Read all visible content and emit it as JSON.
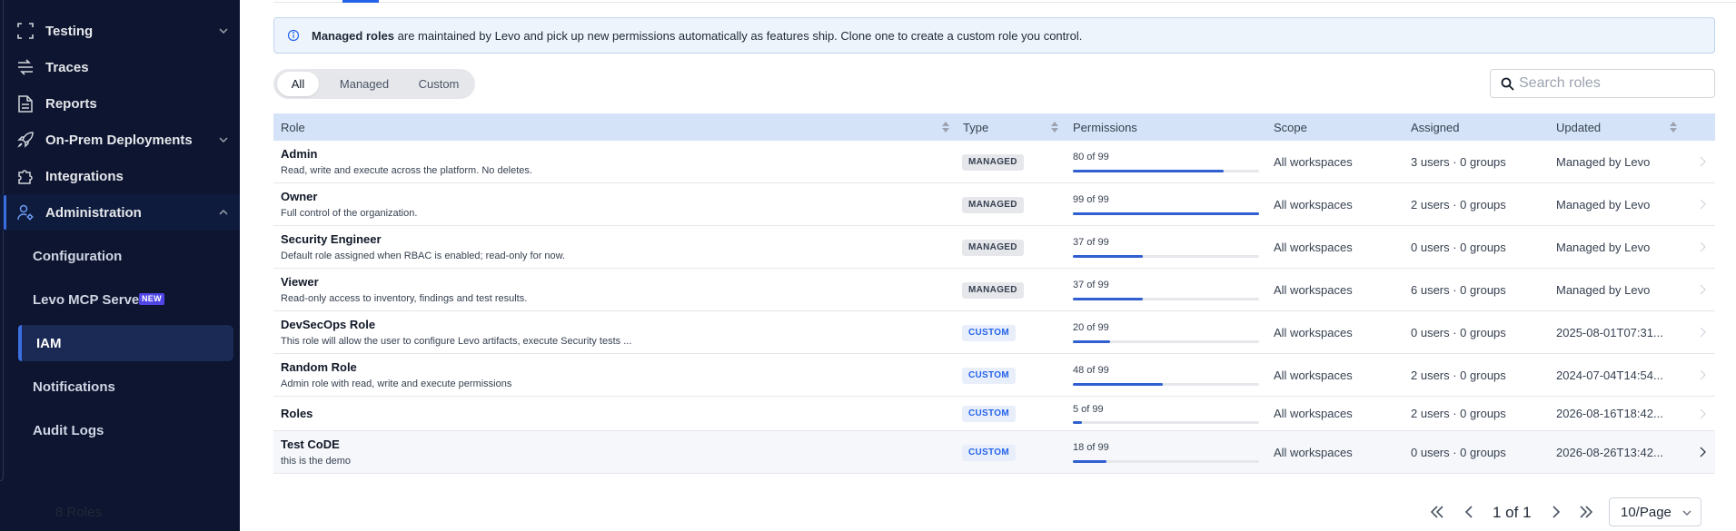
{
  "sidebar": {
    "items": [
      {
        "label": "Testing",
        "icon": "scan-icon",
        "has_chevron": true
      },
      {
        "label": "Traces",
        "icon": "traces-icon",
        "has_chevron": false
      },
      {
        "label": "Reports",
        "icon": "document-icon",
        "has_chevron": false
      },
      {
        "label": "On-Prem Deployments",
        "icon": "rocket-icon",
        "has_chevron": true
      },
      {
        "label": "Integrations",
        "icon": "puzzle-icon",
        "has_chevron": false
      },
      {
        "label": "Administration",
        "icon": "user-gear-icon",
        "has_chevron": true,
        "expanded": true
      }
    ],
    "sub_items": [
      {
        "label": "Configuration"
      },
      {
        "label": "Levo MCP Server",
        "badge": "NEW"
      },
      {
        "label": "IAM",
        "selected": true
      },
      {
        "label": "Notifications"
      },
      {
        "label": "Audit Logs"
      }
    ]
  },
  "banner": {
    "bold": "Managed roles",
    "text": " are maintained by Levo and pick up new permissions automatically as features ship. Clone one to create a custom role you control."
  },
  "filters": {
    "all": "All",
    "managed": "Managed",
    "custom": "Custom",
    "active": "All"
  },
  "search": {
    "placeholder": "Search roles",
    "value": ""
  },
  "table": {
    "headers": {
      "role": "Role",
      "type": "Type",
      "permissions": "Permissions",
      "scope": "Scope",
      "assigned": "Assigned",
      "updated": "Updated"
    },
    "rows": [
      {
        "name": "Admin",
        "desc": "Read, write and execute across the platform. No deletes.",
        "type": "MANAGED",
        "perm_text": "80 of 99",
        "perm": 80,
        "perm_total": 99,
        "scope": "All workspaces",
        "assigned": "3 users · 0 groups",
        "updated": "Managed by Levo"
      },
      {
        "name": "Owner",
        "desc": "Full control of the organization.",
        "type": "MANAGED",
        "perm_text": "99 of 99",
        "perm": 99,
        "perm_total": 99,
        "scope": "All workspaces",
        "assigned": "2 users · 0 groups",
        "updated": "Managed by Levo"
      },
      {
        "name": "Security Engineer",
        "desc": "Default role assigned when RBAC is enabled; read-only for now.",
        "type": "MANAGED",
        "perm_text": "37 of 99",
        "perm": 37,
        "perm_total": 99,
        "scope": "All workspaces",
        "assigned": "0 users · 0 groups",
        "updated": "Managed by Levo"
      },
      {
        "name": "Viewer",
        "desc": "Read-only access to inventory, findings and test results.",
        "type": "MANAGED",
        "perm_text": "37 of 99",
        "perm": 37,
        "perm_total": 99,
        "scope": "All workspaces",
        "assigned": "6 users · 0 groups",
        "updated": "Managed by Levo"
      },
      {
        "name": "DevSecOps Role",
        "desc": "This role will allow the user to configure Levo artifacts, execute Security tests ...",
        "type": "CUSTOM",
        "perm_text": "20 of 99",
        "perm": 20,
        "perm_total": 99,
        "scope": "All workspaces",
        "assigned": "0 users · 0 groups",
        "updated": "2025-08-01T07:31..."
      },
      {
        "name": "Random Role",
        "desc": "Admin role with read, write and execute permissions",
        "type": "CUSTOM",
        "perm_text": "48 of 99",
        "perm": 48,
        "perm_total": 99,
        "scope": "All workspaces",
        "assigned": "2 users · 0 groups",
        "updated": "2024-07-04T14:54..."
      },
      {
        "name": "Roles",
        "desc": "",
        "type": "CUSTOM",
        "perm_text": "5 of 99",
        "perm": 5,
        "perm_total": 99,
        "scope": "All workspaces",
        "assigned": "2 users · 0 groups",
        "updated": "2026-08-16T18:42..."
      },
      {
        "name": "Test CoDE",
        "desc": "this is the demo",
        "type": "CUSTOM",
        "perm_text": "18 of 99",
        "perm": 18,
        "perm_total": 99,
        "scope": "All workspaces",
        "assigned": "0 users · 0 groups",
        "updated": "2026-08-26T13:42..."
      }
    ]
  },
  "footer": {
    "count": "8 Roles",
    "page_info": "1 of 1",
    "page_size": "10/Page"
  },
  "colors": {
    "sidebar_bg": "#0d1530",
    "accent": "#2563eb",
    "header_bg": "#d4e3f7",
    "banner_bg": "#eef4fc"
  }
}
